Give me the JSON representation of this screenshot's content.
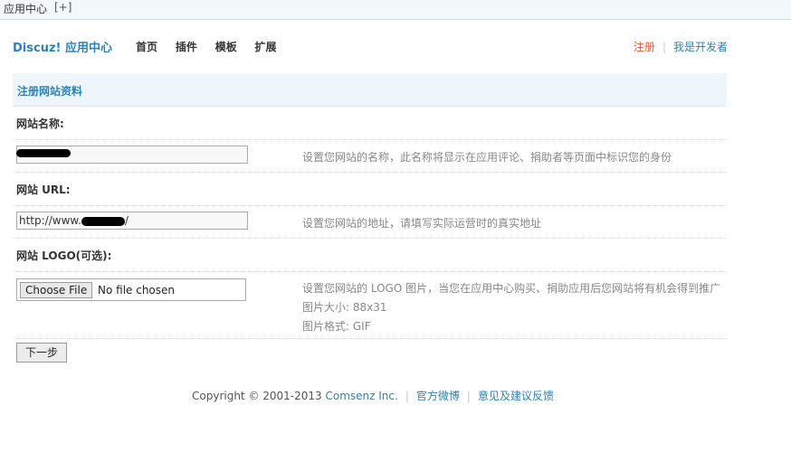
{
  "window": {
    "title": "应用中心",
    "plus": "[+]"
  },
  "header": {
    "brand": "Discuz! 应用中心",
    "nav": [
      "首页",
      "插件",
      "模板",
      "扩展"
    ],
    "register": "注册",
    "developer": "我是开发者"
  },
  "form": {
    "heading": "注册网站资料",
    "site_name": {
      "label": "网站名称:",
      "value": "",
      "hint": "设置您网站的名称，此名称将显示在应用评论、捐助者等页面中标识您的身份"
    },
    "site_url": {
      "label": "网站 URL:",
      "value": "http://www.",
      "value_suffix": "/",
      "hint": "设置您网站的地址，请填写实际运营时的真实地址"
    },
    "site_logo": {
      "label": "网站 LOGO(可选):",
      "file_button": "Choose File",
      "file_status": "No file chosen",
      "hints": [
        "设置您网站的 LOGO 图片，当您在应用中心购买、捐助应用后您网站将有机会得到推广",
        "图片大小: 88x31",
        "图片格式: GIF"
      ]
    },
    "next_button": "下一步"
  },
  "footer": {
    "copyright": "Copyright © 2001-2013 ",
    "company": "Comsenz Inc.",
    "weibo": "官方微博",
    "feedback": "意见及建议反馈"
  },
  "colors": {
    "brand": "#2b83b8",
    "register": "#e8552b",
    "panel_bg": "#eef6fb"
  }
}
